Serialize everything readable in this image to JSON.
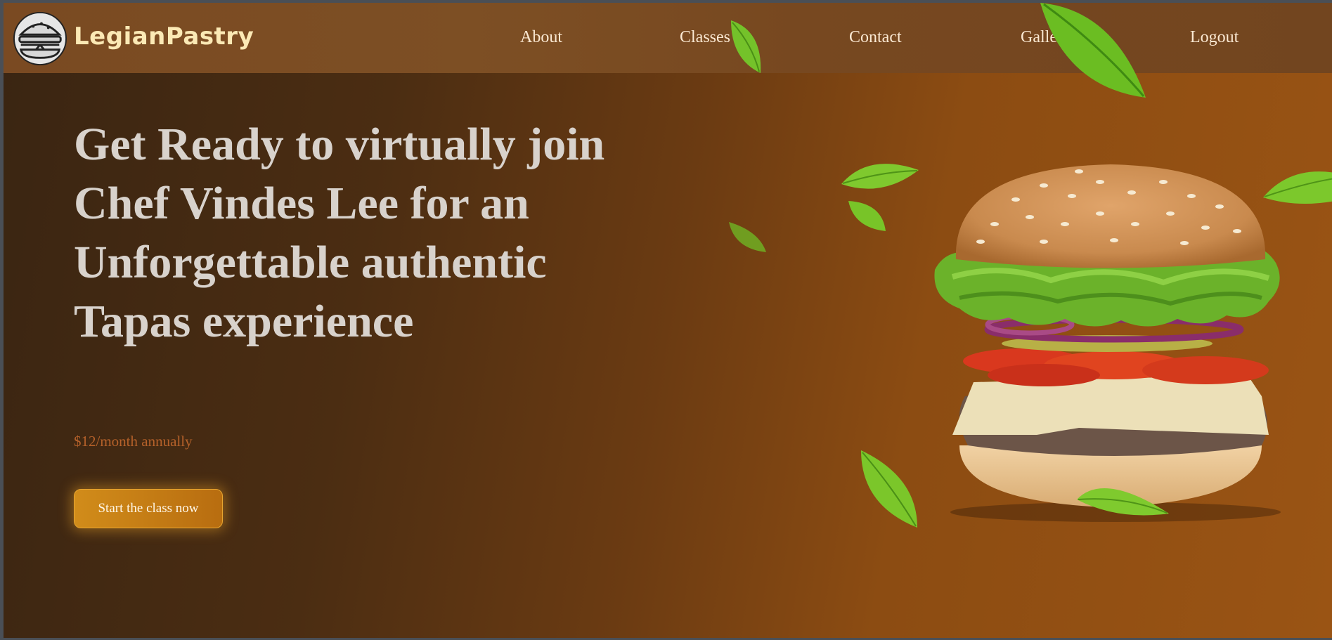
{
  "brand": {
    "name": "LegianPastry",
    "logo_icon": "burger-icon"
  },
  "nav": {
    "links": [
      {
        "label": "About"
      },
      {
        "label": "Classes"
      },
      {
        "label": "Contact"
      },
      {
        "label": "Gallery"
      },
      {
        "label": "Logout"
      }
    ]
  },
  "hero": {
    "title": "Get Ready to virtually join Chef Vindes Lee for an Unforgettable authentic Tapas experience",
    "price": "$12/month annually",
    "cta_label": "Start the class now",
    "image_icon": "burger-illustration"
  },
  "colors": {
    "background_dark": "#3a2512",
    "background_light": "#9a5414",
    "nav_bg": "#7a4a22",
    "accent": "#d18c1a",
    "price_text": "#b5612a",
    "title_text": "#d8d2cc"
  }
}
